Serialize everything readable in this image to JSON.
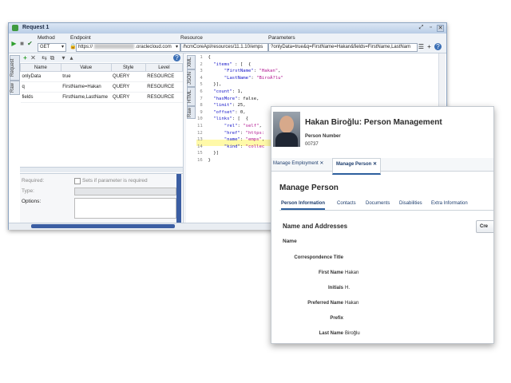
{
  "request": {
    "title": "Request 1",
    "method_label": "Method",
    "method_value": "GET",
    "endpoint_label": "Endpoint",
    "endpoint_value": "https://",
    "endpoint_suffix": ".oraclecloud.com",
    "resource_label": "Resource",
    "resource_value": "/hcmCoreApi/resources/11.1.10/emps",
    "parameters_label": "Parameters",
    "parameters_value": "?onlyData=true&q=FirstName=Hakan&fields=FirstName,LastNam",
    "vtabs": [
      "Request",
      "Raw"
    ],
    "params_columns": [
      "Name",
      "Value",
      "Style",
      "Level"
    ],
    "params_rows": [
      {
        "name": "onlyData",
        "value": "true",
        "style": "QUERY",
        "level": "RESOURCE"
      },
      {
        "name": "q",
        "value": "FirstName=Hakan",
        "style": "QUERY",
        "level": "RESOURCE"
      },
      {
        "name": "fields",
        "value": "FirstName,LastName",
        "style": "QUERY",
        "level": "RESOURCE"
      }
    ],
    "prop_required": "Required:",
    "prop_required_check": "Sets if parameter is required",
    "prop_type": "Type:",
    "prop_options": "Options:",
    "resp_vtabs": [
      "XML",
      "JSON",
      "HTML",
      "Raw"
    ]
  },
  "code_lines": [
    {
      "n": "1",
      "text": "{"
    },
    {
      "n": "2",
      "text": "  \"items\" : [  {"
    },
    {
      "n": "3",
      "text": "      \"FirstName\": \"Hakan\","
    },
    {
      "n": "4",
      "text": "      \"LastName\": \"BiroÃ?lu\""
    },
    {
      "n": "5",
      "text": "  }],"
    },
    {
      "n": "6",
      "text": "  \"count\": 1,"
    },
    {
      "n": "7",
      "text": "  \"hasMore\": false,"
    },
    {
      "n": "8",
      "text": "  \"limit\": 25,"
    },
    {
      "n": "9",
      "text": "  \"offset\": 0,"
    },
    {
      "n": "10",
      "text": "  \"links\": [  {"
    },
    {
      "n": "11",
      "text": "      \"rel\": \"self\","
    },
    {
      "n": "12",
      "text": "      \"href\": \"https:"
    },
    {
      "n": "13",
      "text": "      \"name\": \"emps\","
    },
    {
      "n": "14",
      "text": "      \"kind\": \"collec"
    },
    {
      "n": "15",
      "text": "  }]"
    },
    {
      "n": "16",
      "text": "}"
    }
  ],
  "person": {
    "title": "Hakan Biroğlu: Person Management",
    "number_label": "Person Number",
    "number_value": "00737",
    "tabs": [
      "Manage Employment",
      "Manage Person"
    ],
    "heading": "Manage Person",
    "subtabs": [
      "Person Information",
      "Contacts",
      "Documents",
      "Disabilities",
      "Extra Information"
    ],
    "section_title": "Name and Addresses",
    "create_label": "Cre",
    "name_header": "Name",
    "fields": [
      {
        "label": "Correspondence Title",
        "value": ""
      },
      {
        "label": "First Name",
        "value": "Hakan"
      },
      {
        "label": "Initials",
        "value": "H."
      },
      {
        "label": "Preferred Name",
        "value": "Hakan"
      },
      {
        "label": "Prefix",
        "value": ""
      },
      {
        "label": "Last Name",
        "value": "Biroğlu"
      }
    ]
  },
  "colors": {
    "accent": "#2d5f9e",
    "highlight": "#fff9a8",
    "run": "#2fa02f"
  }
}
